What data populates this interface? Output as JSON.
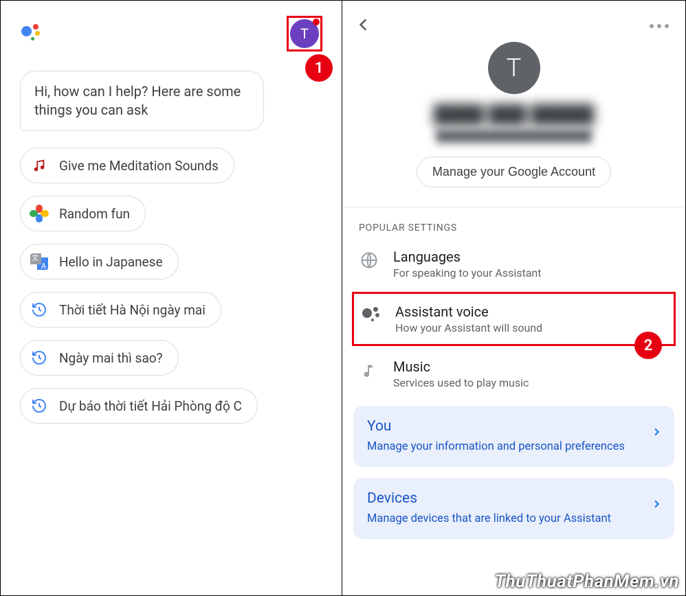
{
  "left": {
    "avatar_letter": "T",
    "greeting": "Hi, how can I help? Here are some things you can ask",
    "chips": [
      {
        "label": "Give me Meditation Sounds",
        "icon": "music-note-icon"
      },
      {
        "label": "Random fun",
        "icon": "fan-icon"
      },
      {
        "label": "Hello in Japanese",
        "icon": "translate-icon"
      },
      {
        "label": "Thời tiết Hà Nội ngày mai",
        "icon": "history-icon"
      },
      {
        "label": "Ngày mai thì sao?",
        "icon": "history-icon"
      },
      {
        "label": "Dự báo thời tiết Hải Phòng độ C",
        "icon": "history-icon"
      }
    ]
  },
  "right": {
    "avatar_letter": "T",
    "profile_name": "████ ███ █████",
    "profile_email": "████████████████████",
    "manage_button": "Manage your Google Account",
    "section_label": "POPULAR SETTINGS",
    "settings": [
      {
        "title": "Languages",
        "sub": "For speaking to your Assistant",
        "icon": "globe-icon"
      },
      {
        "title": "Assistant voice",
        "sub": "How your Assistant will sound",
        "icon": "assistant-icon"
      },
      {
        "title": "Music",
        "sub": "Services used to play music",
        "icon": "music-note-icon"
      }
    ],
    "cards": [
      {
        "title": "You",
        "sub": "Manage your information and personal preferences"
      },
      {
        "title": "Devices",
        "sub": "Manage devices that are linked to your Assistant"
      }
    ]
  },
  "annotations": {
    "one": "1",
    "two": "2"
  },
  "watermark": "ThuThuatPhanMem.vn",
  "colors": {
    "accent_red": "#e60012",
    "link_blue": "#1a73e8",
    "avatar_purple": "#6b3fbf"
  }
}
